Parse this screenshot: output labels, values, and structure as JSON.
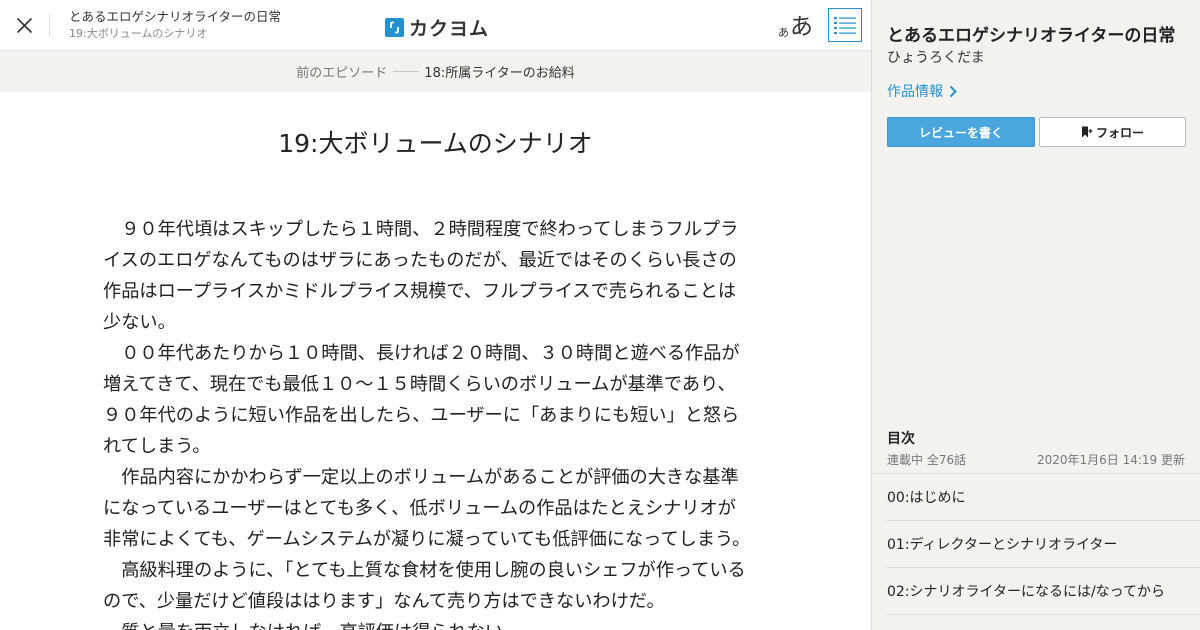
{
  "header": {
    "work_title": "とあるエロゲシナリオライターの日常",
    "episode_subtitle": "19:大ボリュームのシナリオ",
    "logo_mark": "「」",
    "logo_text": "カクヨム",
    "font_small": "あ",
    "font_large": "あ"
  },
  "prev_episode": {
    "label": "前のエピソード",
    "title": "18:所属ライターのお給料"
  },
  "episode": {
    "title": "19:大ボリュームのシナリオ",
    "paragraphs": [
      "　９０年代頃はスキップしたら１時間、２時間程度で終わってしまうフルプライスのエロゲなんてものはザラにあったものだが、最近ではそのくらい長さの作品はロープライスかミドルプライス規模で、フルプライスで売られることは少ない。",
      "　００年代あたりから１０時間、長ければ２０時間、３０時間と遊べる作品が増えてきて、現在でも最低１０～１５時間くらいのボリュームが基準であり、９０年代のように短い作品を出したら、ユーザーに「あまりにも短い」と怒られてしまう。",
      "　作品内容にかかわらず一定以上のボリュームがあることが評価の大きな基準になっているユーザーはとても多く、低ボリュームの作品はたとえシナリオが非常によくても、ゲームシステムが凝りに凝っていても低評価になってしまう。",
      "　高級料理のように、「とても上質な食材を使用し腕の良いシェフが作っているので、少量だけど値段ははります」なんて売り方はできないわけだ。",
      "　質と量を両立しなければ、高評価は得られない。"
    ]
  },
  "sidebar": {
    "title": "とあるエロゲシナリオライターの日常",
    "author": "ひょうろくだま",
    "info_link": "作品情報",
    "review_button": "レビューを書く",
    "follow_button": "フォロー",
    "toc_heading": "目次",
    "toc_status": "連載中 全76話",
    "toc_updated": "2020年1月6日 14:19 更新",
    "toc_items": [
      "00:はじめに",
      "01:ディレクターとシナリオライター",
      "02:シナリオライターになるには/なってから"
    ]
  },
  "colors": {
    "accent": "#2390d0",
    "review_button_bg": "#4aa6dd",
    "sidebar_bg": "#f3f2ef"
  },
  "icons": {
    "close": "close-icon",
    "toc": "list-icon",
    "chevron": "chevron-right-icon",
    "bookmark": "bookmark-plus-icon"
  }
}
